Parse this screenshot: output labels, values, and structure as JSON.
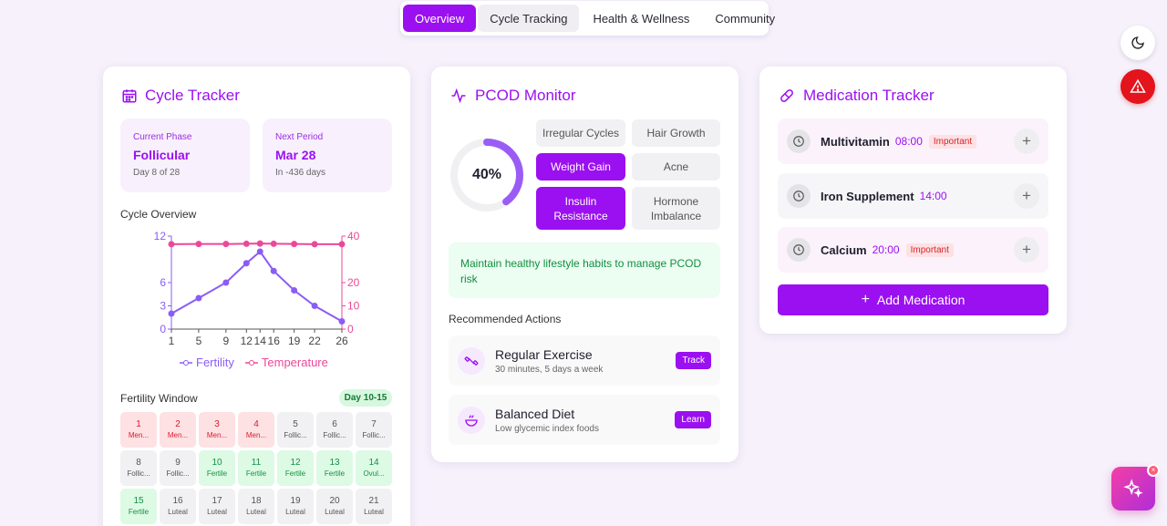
{
  "nav": {
    "tabs": [
      {
        "label": "Overview"
      },
      {
        "label": "Cycle Tracking"
      },
      {
        "label": "Health & Wellness"
      },
      {
        "label": "Community"
      }
    ]
  },
  "cycle": {
    "title": "Cycle Tracker",
    "current_phase_label": "Current Phase",
    "current_phase_value": "Follicular",
    "current_phase_sub": "Day 8 of 28",
    "next_period_label": "Next Period",
    "next_period_value": "Mar 28",
    "next_period_sub": "In -436 days",
    "overview_label": "Cycle Overview",
    "legend_fertility": "Fertility",
    "legend_temperature": "Temperature",
    "fertility_window_label": "Fertility Window",
    "fertility_window_badge": "Day 10-15",
    "days": [
      {
        "n": "1",
        "t": "Men...",
        "k": "men"
      },
      {
        "n": "2",
        "t": "Men...",
        "k": "men"
      },
      {
        "n": "3",
        "t": "Men...",
        "k": "men"
      },
      {
        "n": "4",
        "t": "Men...",
        "k": "men"
      },
      {
        "n": "5",
        "t": "Follic...",
        "k": "fol"
      },
      {
        "n": "6",
        "t": "Follic...",
        "k": "fol"
      },
      {
        "n": "7",
        "t": "Follic...",
        "k": "fol"
      },
      {
        "n": "8",
        "t": "Follic...",
        "k": "fol"
      },
      {
        "n": "9",
        "t": "Follic...",
        "k": "fol"
      },
      {
        "n": "10",
        "t": "Fertile",
        "k": "fer"
      },
      {
        "n": "11",
        "t": "Fertile",
        "k": "fer"
      },
      {
        "n": "12",
        "t": "Fertile",
        "k": "fer"
      },
      {
        "n": "13",
        "t": "Fertile",
        "k": "fer"
      },
      {
        "n": "14",
        "t": "Ovul...",
        "k": "ovu"
      },
      {
        "n": "15",
        "t": "Fertile",
        "k": "fer"
      },
      {
        "n": "16",
        "t": "Luteal",
        "k": "lut"
      },
      {
        "n": "17",
        "t": "Luteal",
        "k": "lut"
      },
      {
        "n": "18",
        "t": "Luteal",
        "k": "lut"
      },
      {
        "n": "19",
        "t": "Luteal",
        "k": "lut"
      },
      {
        "n": "20",
        "t": "Luteal",
        "k": "lut"
      },
      {
        "n": "21",
        "t": "Luteal",
        "k": "lut"
      }
    ]
  },
  "chart_data": {
    "type": "line",
    "x": [
      1,
      5,
      9,
      12,
      14,
      16,
      19,
      22,
      26
    ],
    "x_ticks": [
      "1",
      "5",
      "9",
      "12",
      "14",
      "16",
      "19",
      "22",
      "26"
    ],
    "series": [
      {
        "name": "Fertility",
        "axis": "left",
        "color": "#8b5cf6",
        "values": [
          2,
          4,
          6,
          8.5,
          10,
          7.5,
          5,
          3,
          1
        ]
      },
      {
        "name": "Temperature",
        "axis": "right",
        "color": "#ec4899",
        "values": [
          36.5,
          36.6,
          36.6,
          36.7,
          36.8,
          36.7,
          36.6,
          36.5,
          36.5
        ]
      }
    ],
    "y_left": {
      "ticks": [
        "0",
        "3",
        "6",
        "12"
      ],
      "lim": [
        0,
        12
      ]
    },
    "y_right": {
      "ticks": [
        "0",
        "10",
        "20",
        "40"
      ],
      "lim": [
        0,
        40
      ]
    }
  },
  "pcod": {
    "title": "PCOD Monitor",
    "score": "40%",
    "score_fraction": 0.4,
    "symptoms": [
      {
        "label": "Irregular Cycles",
        "on": false
      },
      {
        "label": "Hair Growth",
        "on": false
      },
      {
        "label": "Weight Gain",
        "on": true
      },
      {
        "label": "Acne",
        "on": false
      },
      {
        "label": "Insulin Resistance",
        "on": true
      },
      {
        "label": "Hormone Imbalance",
        "on": false
      }
    ],
    "advice": "Maintain healthy lifestyle habits to manage PCOD risk",
    "actions_label": "Recommended Actions",
    "actions": [
      {
        "title": "Regular Exercise",
        "sub": "30 minutes, 5 days a week",
        "btn": "Track",
        "icon": "dumbbell-icon"
      },
      {
        "title": "Balanced Diet",
        "sub": "Low glycemic index foods",
        "btn": "Learn",
        "icon": "bowl-icon"
      }
    ]
  },
  "meds": {
    "title": "Medication Tracker",
    "items": [
      {
        "name": "Multivitamin",
        "time": "08:00",
        "tag": "Important"
      },
      {
        "name": "Iron Supplement",
        "time": "14:00",
        "tag": ""
      },
      {
        "name": "Calcium",
        "time": "20:00",
        "tag": "Important"
      }
    ],
    "add_label": "Add Medication"
  },
  "colors": {
    "accent": "#9b10f0",
    "alert": "#e3141b",
    "fertility": "#8b5cf6",
    "temperature": "#ec4899"
  }
}
